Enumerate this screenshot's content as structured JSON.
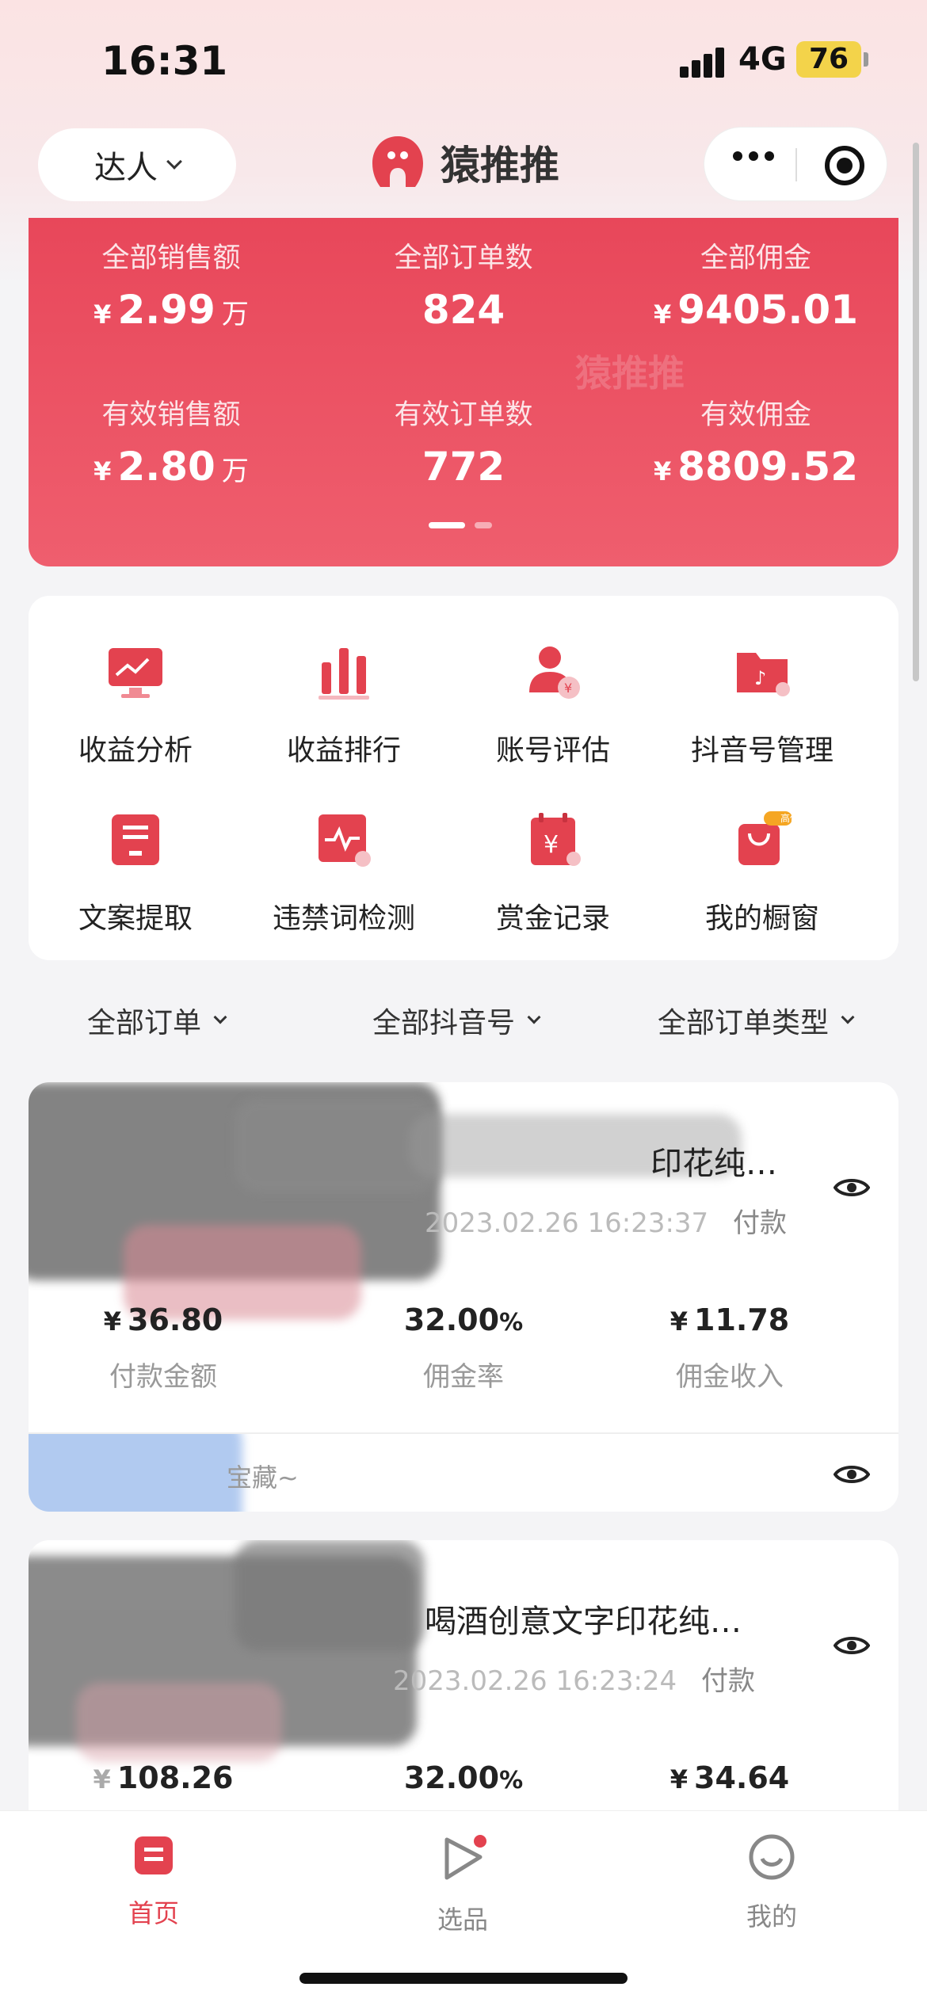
{
  "status_bar": {
    "time": "16:31",
    "network": "4G",
    "battery": "76"
  },
  "nav": {
    "role_label": "达人",
    "app_name": "猿推推"
  },
  "stats": {
    "watermark": "猿推推",
    "items": [
      {
        "label": "全部销售额",
        "currency": "¥",
        "value": "2.99",
        "unit": "万"
      },
      {
        "label": "全部订单数",
        "currency": "",
        "value": "824",
        "unit": ""
      },
      {
        "label": "全部佣金",
        "currency": "¥",
        "value": "9405.01",
        "unit": ""
      },
      {
        "label": "有效销售额",
        "currency": "¥",
        "value": "2.80",
        "unit": "万"
      },
      {
        "label": "有效订单数",
        "currency": "",
        "value": "772",
        "unit": ""
      },
      {
        "label": "有效佣金",
        "currency": "¥",
        "value": "8809.52",
        "unit": ""
      }
    ]
  },
  "tools": [
    {
      "label": "收益分析",
      "icon": "monitor-chart-icon"
    },
    {
      "label": "收益排行",
      "icon": "bar-chart-icon"
    },
    {
      "label": "账号评估",
      "icon": "user-yen-icon"
    },
    {
      "label": "抖音号管理",
      "icon": "douyin-folder-icon"
    },
    {
      "label": "文案提取",
      "icon": "document-icon"
    },
    {
      "label": "违禁词检测",
      "icon": "pulse-check-icon"
    },
    {
      "label": "赏金记录",
      "icon": "yen-calendar-icon"
    },
    {
      "label": "我的橱窗",
      "icon": "shopping-bag-icon",
      "badge": "高佣"
    }
  ],
  "filters": {
    "orders": "全部订单",
    "accounts": "全部抖音号",
    "order_types": "全部订单类型"
  },
  "orders": [
    {
      "title": "印花纯…",
      "time": "2023.02.26 16:23:37",
      "status": "付款",
      "payment": "36.80",
      "rate": "32.00",
      "rate_unit": "%",
      "commission": "11.78",
      "payment_label": "付款金额",
      "rate_label": "佣金率",
      "commission_label": "佣金收入",
      "note": "宝藏~"
    },
    {
      "title": "喝酒创意文字印花纯…",
      "time": "2023.02.26 16:23:24",
      "status": "付款",
      "payment": "108.26",
      "rate": "32.00",
      "rate_unit": "%",
      "commission": "34.64"
    }
  ],
  "currency_symbol": "¥",
  "bottom_nav": {
    "home": "首页",
    "select": "选品",
    "mine": "我的"
  },
  "colors": {
    "brand_red": "#e3424f",
    "card_red": "#e8475a"
  }
}
